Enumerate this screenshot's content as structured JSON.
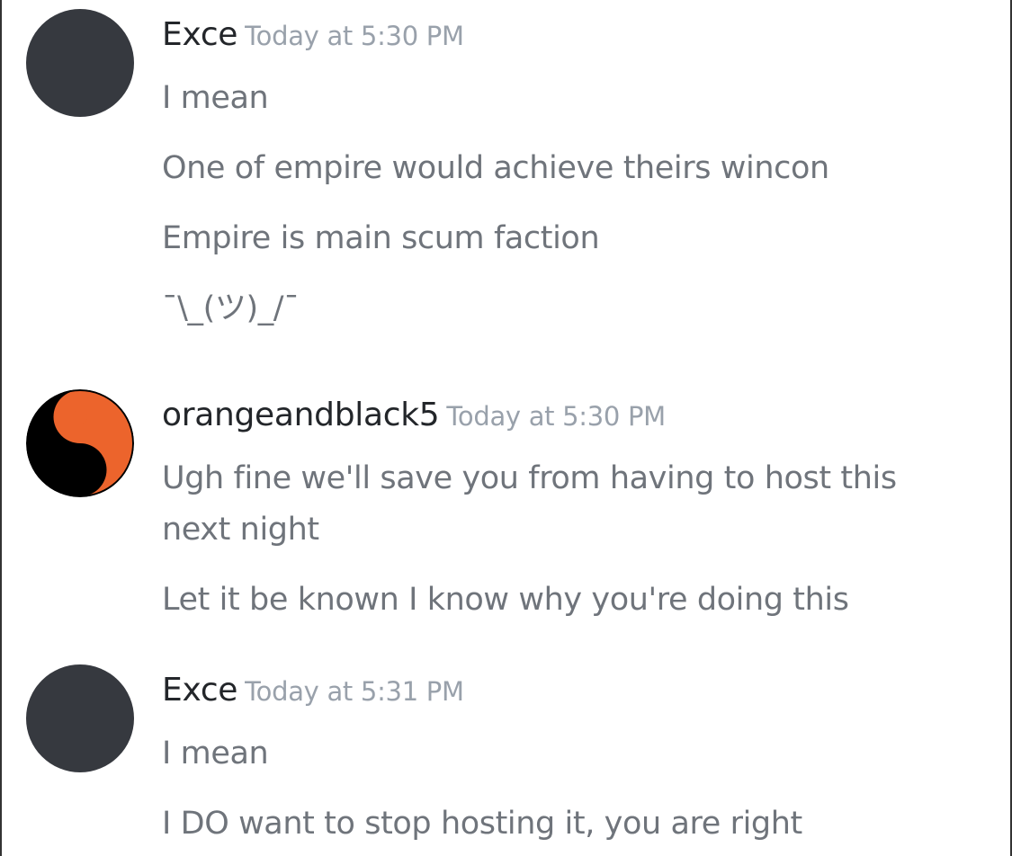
{
  "messages": [
    {
      "author": "Exce",
      "timestamp": "Today at 5:30 PM",
      "avatar": "dark-circle",
      "lines": [
        "I mean",
        "One of empire would achieve theirs wincon",
        "Empire is main scum faction",
        "¯\\_(ツ)_/¯"
      ]
    },
    {
      "author": "orangeandblack5",
      "timestamp": "Today at 5:30 PM",
      "avatar": "yin-yang-orange-black",
      "lines": [
        "Ugh fine we'll save you from having to host this next night",
        "Let it be known I know why you're doing this"
      ]
    },
    {
      "author": "Exce",
      "timestamp": "Today at 5:31 PM",
      "avatar": "dark-circle",
      "lines": [
        "I mean",
        "I DO want to stop hosting it, you are right"
      ]
    }
  ],
  "colors": {
    "username": "#23262a",
    "timestamp": "#99a1ab",
    "message_text": "#6f747b",
    "avatar_dark": "#36393f",
    "avatar_orange": "#ec642c",
    "avatar_black": "#000000"
  }
}
